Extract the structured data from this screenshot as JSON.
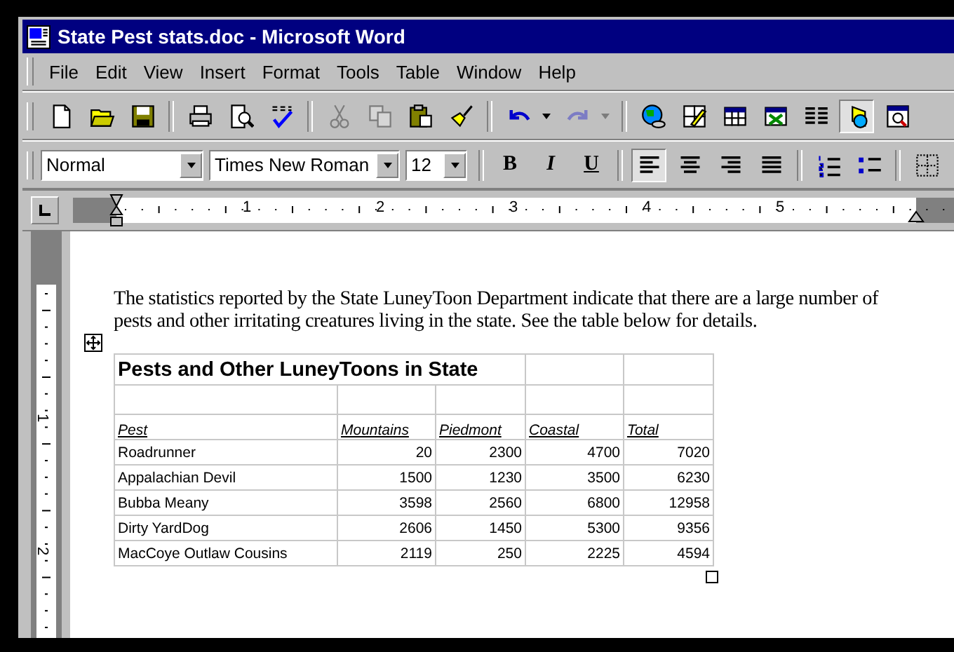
{
  "window": {
    "title": "State Pest stats.doc - Microsoft Word"
  },
  "menu": [
    "File",
    "Edit",
    "View",
    "Insert",
    "Format",
    "Tools",
    "Table",
    "Window",
    "Help"
  ],
  "standard_toolbar": [
    [
      {
        "kind": "button",
        "disabled": false,
        "pressed": false
      },
      {
        "kind": "button",
        "disabled": false,
        "pressed": false
      },
      {
        "kind": "button",
        "disabled": false,
        "pressed": false
      }
    ],
    [
      {
        "kind": "button",
        "disabled": false,
        "pressed": false
      },
      {
        "kind": "button",
        "disabled": false,
        "pressed": false
      },
      {
        "kind": "button",
        "disabled": false,
        "pressed": false
      }
    ],
    [
      {
        "kind": "button",
        "disabled": true,
        "pressed": false
      },
      {
        "kind": "button",
        "disabled": true,
        "pressed": false
      },
      {
        "kind": "button",
        "disabled": false,
        "pressed": false
      },
      {
        "kind": "button",
        "disabled": false,
        "pressed": false
      }
    ],
    [
      {
        "kind": "split",
        "disabled": false,
        "pressed": false
      },
      {
        "kind": "split",
        "disabled": true,
        "pressed": false
      }
    ],
    [
      {
        "kind": "button",
        "disabled": false,
        "pressed": false
      },
      {
        "kind": "button",
        "disabled": false,
        "pressed": false
      },
      {
        "kind": "button",
        "disabled": false,
        "pressed": false
      },
      {
        "kind": "button",
        "disabled": false,
        "pressed": false
      },
      {
        "kind": "button",
        "disabled": false,
        "pressed": false
      },
      {
        "kind": "button",
        "disabled": false,
        "pressed": true
      },
      {
        "kind": "button",
        "disabled": false,
        "pressed": false
      }
    ]
  ],
  "format_toolbar": {
    "style": "Normal",
    "font": "Times New Roman",
    "size": "12",
    "text_buttons": [
      {
        "label": "B",
        "pressed": false
      },
      {
        "label": "I",
        "pressed": false
      },
      {
        "label": "U",
        "pressed": false
      }
    ],
    "align_buttons": [
      {
        "pressed": true
      },
      {
        "pressed": false
      },
      {
        "pressed": false
      },
      {
        "pressed": false
      }
    ],
    "list_buttons": [
      {
        "pressed": false
      },
      {
        "pressed": false
      }
    ],
    "border_buttons": [
      {
        "pressed": false
      }
    ]
  },
  "ruler": {
    "numbers": [
      "1",
      "2",
      "3",
      "4",
      "5"
    ]
  },
  "vertical_ruler": {
    "numbers": [
      "1",
      "2"
    ]
  },
  "document": {
    "paragraph": "The statistics reported by the State LuneyToon Department indicate that there are a large number of pests and other irritating creatures living in the state.  See the table below for details.",
    "table": {
      "title": "Pests and Other LuneyToons in State",
      "columns": [
        "Pest",
        "Mountains",
        "Piedmont",
        "Coastal",
        "Total"
      ],
      "rows": [
        [
          "Roadrunner",
          "20",
          "2300",
          "4700",
          "7020"
        ],
        [
          "Appalachian Devil",
          "1500",
          "1230",
          "3500",
          "6230"
        ],
        [
          "Bubba Meany",
          "3598",
          "2560",
          "6800",
          "12958"
        ],
        [
          "Dirty YardDog",
          "2606",
          "1450",
          "5300",
          "9356"
        ],
        [
          "MacCoye Outlaw Cousins",
          "2119",
          "250",
          "2225",
          "4594"
        ]
      ]
    }
  }
}
